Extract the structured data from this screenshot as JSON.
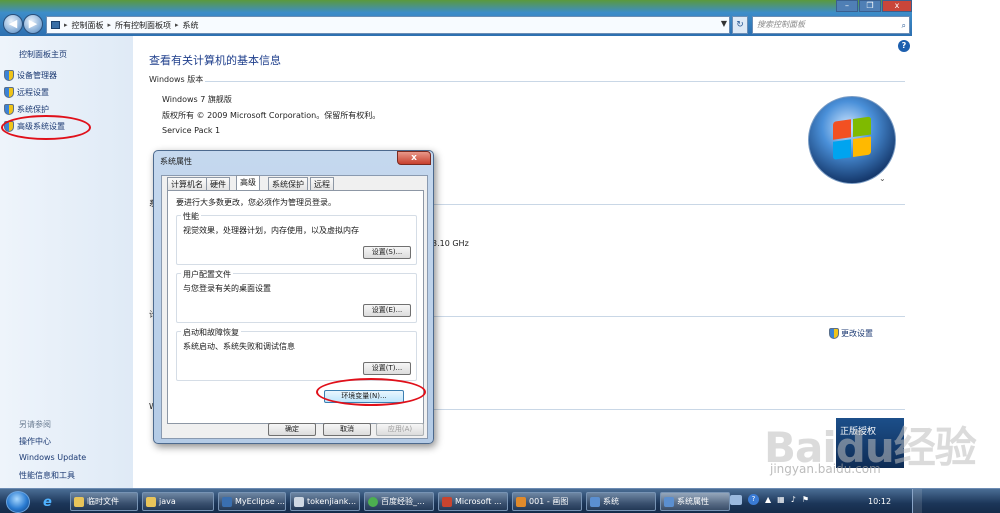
{
  "address_bar": {
    "crumbs": [
      "控制面板",
      "所有控制面板项",
      "系统"
    ],
    "search_placeholder": "搜索控制面板"
  },
  "sidebar": {
    "home": "控制面板主页",
    "items": [
      "设备管理器",
      "远程设置",
      "系统保护",
      "高级系统设置"
    ],
    "see_also_title": "另请参阅",
    "see_also": [
      "操作中心",
      "Windows Update",
      "性能信息和工具"
    ]
  },
  "main": {
    "title": "查看有关计算机的基本信息",
    "edition_section": "Windows 版本",
    "edition": "Windows 7 旗舰版",
    "copyright": "版权所有 © 2009 Microsoft Corporation。保留所有权利。",
    "service_pack": "Service Pack 1",
    "cpu_fragment": "3.10 GHz",
    "change_settings": "更改设置",
    "section_fragments": [
      "系",
      "计",
      "W"
    ],
    "genuine_text": "正版授权"
  },
  "dialog": {
    "title": "系统属性",
    "close": "x",
    "tabs": [
      "计算机名",
      "硬件",
      "高级",
      "系统保护",
      "远程"
    ],
    "active_tab": "高级",
    "admin_note": "要进行大多数更改，您必须作为管理员登录。",
    "groups": [
      {
        "label": "性能",
        "desc": "视觉效果，处理器计划，内存使用，以及虚拟内存",
        "button": "设置(S)..."
      },
      {
        "label": "用户配置文件",
        "desc": "与您登录有关的桌面设置",
        "button": "设置(E)..."
      },
      {
        "label": "启动和故障恢复",
        "desc": "系统启动、系统失败和调试信息",
        "button": "设置(T)..."
      }
    ],
    "env_button": "环境变量(N)...",
    "ok": "确定",
    "cancel": "取消",
    "apply": "应用(A)"
  },
  "taskbar": {
    "tasks": [
      "临时文件",
      "java",
      "MyEclipse ...",
      "tokenjiank...",
      "百度经验_...",
      "Microsoft ...",
      "001 - 画图",
      "系统",
      "系统属性"
    ],
    "active_task": "系统属性",
    "clock": "10:12"
  },
  "watermark": {
    "brand": "Baidu经验",
    "url": "jingyan.baidu.com"
  }
}
